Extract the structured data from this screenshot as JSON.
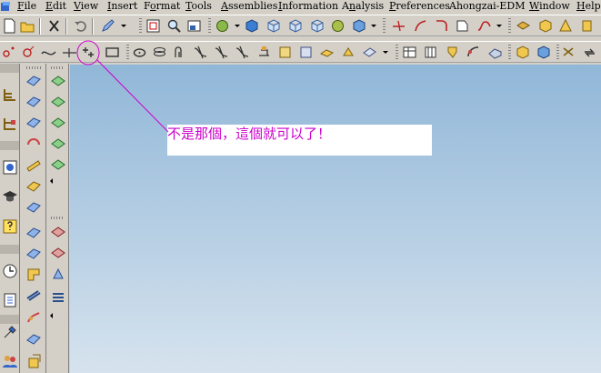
{
  "menu": {
    "items": [
      {
        "hot": "F",
        "rest": "ile"
      },
      {
        "hot": "E",
        "rest": "dit"
      },
      {
        "hot": "V",
        "rest": "iew"
      },
      {
        "hot": "I",
        "rest": "nsert"
      },
      {
        "pre": "F",
        "hot": "o",
        "rest": "rmat"
      },
      {
        "hot": "T",
        "rest": "ools"
      },
      {
        "hot": "A",
        "rest": "ssemblies"
      },
      {
        "hot": "I",
        "rest": "nformation"
      },
      {
        "pre": "A",
        "hot": "n",
        "rest": "alysis"
      },
      {
        "hot": "P",
        "rest": "references"
      },
      {
        "pre": "Ahongzai-EDM",
        "hot": "",
        "rest": ""
      },
      {
        "hot": "W",
        "rest": "indow"
      },
      {
        "hot": "H",
        "rest": "elp"
      }
    ]
  },
  "annotation": {
    "text": "不是那個，這個就可以了！",
    "color": "#cc00cc"
  },
  "icons": {
    "toolbar1": [
      "new-file-icon",
      "open-folder-icon",
      "cut-icon",
      "undo-icon",
      "pen-icon",
      "fit-view-icon",
      "zoom-icon",
      "pan-view-icon",
      "sphere-icon",
      "solid-cube-icon",
      "wire-cube-icon",
      "iso-cube-icon",
      "view-cube-icon",
      "shaded-ball-icon",
      "cube-display-icon",
      "point-icon",
      "curve-icon",
      "fillet-icon",
      "corner-icon",
      "spline-icon",
      "layer-icon",
      "box-icon",
      "cone-icon",
      "cylinder-icon",
      "ghost-icon",
      "sheet-icon"
    ],
    "toolbar2": [
      "point-set-icon",
      "arc-icon",
      "spline-curve-icon",
      "line-icon",
      "point-cross-icon",
      "rectangle-icon",
      "ellipse-icon",
      "helix-icon",
      "offset-curve-icon",
      "trim-curve-icon",
      "bridge-curve-icon",
      "project-curve-icon",
      "extract-curve-icon",
      "curve-on-surface-icon",
      "intersect-curve-icon",
      "section-curve-icon",
      "wrap-curve-icon",
      "surface-curve-icon",
      "table-icon",
      "sketch-icon",
      "feature-icon",
      "edge-icon",
      "blend-icon",
      "datum-icon",
      "assembly-icon",
      "constraint-icon",
      "sync-icon",
      "help-icon"
    ]
  }
}
